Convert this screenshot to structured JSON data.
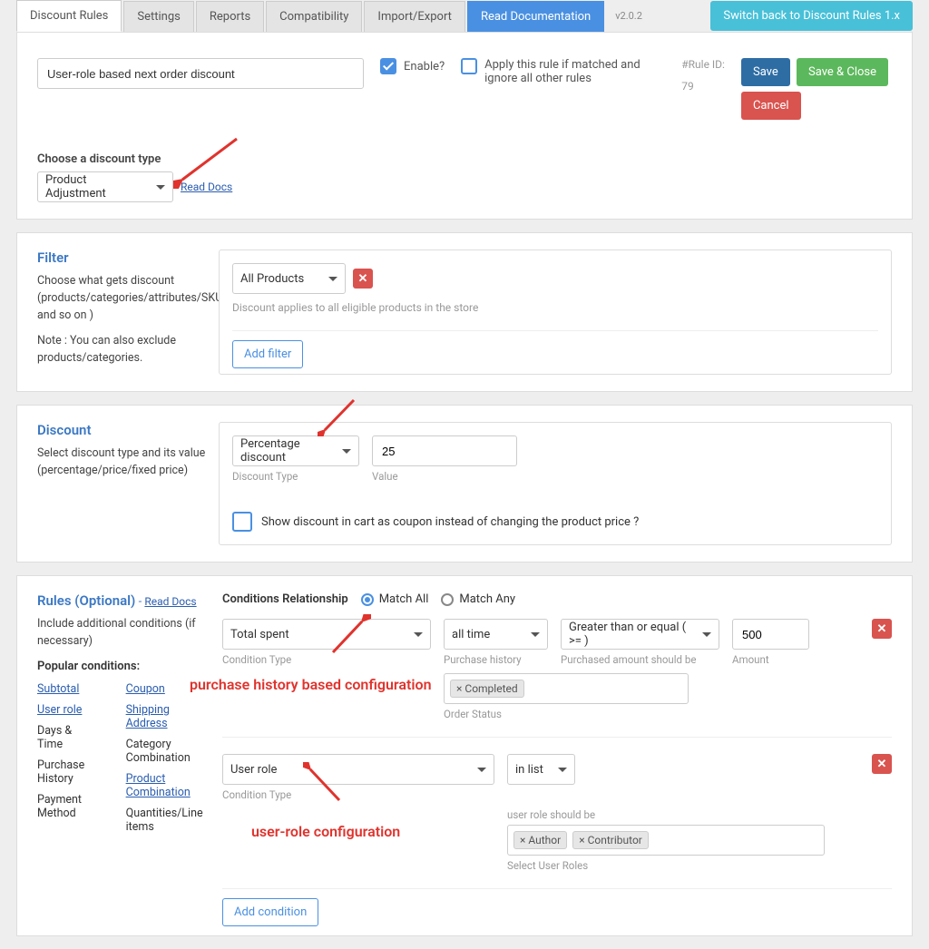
{
  "tabs": {
    "discount_rules": "Discount Rules",
    "settings": "Settings",
    "reports": "Reports",
    "compatibility": "Compatibility",
    "import_export": "Import/Export",
    "documentation": "Read Documentation"
  },
  "version": "v2.0.2",
  "switch_back": "Switch back to Discount Rules 1.x",
  "header": {
    "rule_name": "User-role based next order discount",
    "enable_label": "Enable?",
    "ignore_label": "Apply this rule if matched and ignore all other rules",
    "rule_id_label": "#Rule ID:",
    "rule_id_value": "79",
    "save": "Save",
    "save_close": "Save & Close",
    "cancel": "Cancel",
    "discount_type_label": "Choose a discount type",
    "discount_type_value": "Product Adjustment",
    "read_docs": "Read Docs"
  },
  "filter": {
    "title": "Filter",
    "desc": "Choose what gets discount (products/categories/attributes/SKU and so on )",
    "note": "Note : You can also exclude products/categories.",
    "selected": "All Products",
    "hint": "Discount applies to all eligible products in the store",
    "add_filter": "Add filter"
  },
  "discount": {
    "title": "Discount",
    "desc": "Select discount type and its value (percentage/price/fixed price)",
    "discount_type": "Percentage discount",
    "discount_type_label": "Discount Type",
    "value": "25",
    "value_label": "Value",
    "coupon_check": "Show discount in cart as coupon instead of changing the product price ?"
  },
  "rules": {
    "title": "Rules (Optional)",
    "read_docs": "Read Docs",
    "desc": "Include additional conditions (if necessary)",
    "popular_label": "Popular conditions:",
    "popular_left": [
      "Subtotal",
      "User role",
      "Days & Time",
      "Purchase History",
      "Payment Method"
    ],
    "popular_right": [
      "Coupon",
      "Shipping Address",
      "Category Combination",
      "Product Combination",
      "Quantities/Line items"
    ],
    "conditions_relationship": "Conditions Relationship",
    "match_all": "Match All",
    "match_any": "Match Any",
    "cond1": {
      "type": "Total spent",
      "type_label": "Condition Type",
      "history": "all time",
      "history_label": "Purchase history",
      "op": "Greater than or equal ( >= )",
      "op_label": "Purchased amount should be",
      "amount": "500",
      "amount_label": "Amount",
      "order_status_tag": "× Completed",
      "order_status_label": "Order Status"
    },
    "cond2": {
      "type": "User role",
      "type_label": "Condition Type",
      "op": "in list",
      "role_label": "user role should be",
      "tags": [
        "× Author",
        "× Contributor"
      ],
      "select_label": "Select User Roles"
    },
    "add_condition": "Add condition"
  },
  "annotations": {
    "purchase_history": "purchase history based configuration",
    "user_role": "user-role configuration"
  }
}
